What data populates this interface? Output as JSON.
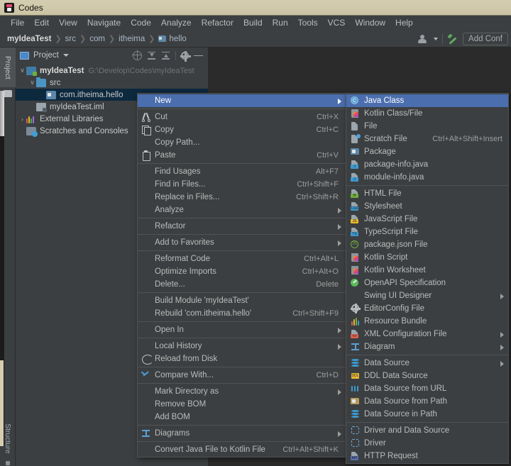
{
  "window": {
    "title": "Codes",
    "icon": "intellij-idea-icon"
  },
  "menubar": {
    "items": [
      {
        "label": "File"
      },
      {
        "label": "Edit"
      },
      {
        "label": "View"
      },
      {
        "label": "Navigate"
      },
      {
        "label": "Code"
      },
      {
        "label": "Analyze"
      },
      {
        "label": "Refactor"
      },
      {
        "label": "Build"
      },
      {
        "label": "Run"
      },
      {
        "label": "Tools"
      },
      {
        "label": "VCS"
      },
      {
        "label": "Window"
      },
      {
        "label": "Help"
      }
    ]
  },
  "navbar": {
    "crumbs": [
      "myIdeaTest",
      "src",
      "com",
      "itheima",
      "hello"
    ],
    "separator": "❯",
    "add_configuration": "Add Conf"
  },
  "toolwindow_strips": {
    "project": "Project",
    "structure": "Structure"
  },
  "project_panel": {
    "title": "Project",
    "tree": [
      {
        "label": "myIdeaTest",
        "path": "G:\\Develop\\Codes\\myIdeaTest",
        "icon": "module-icon",
        "arrow": "∨",
        "depth": 0,
        "bold": true
      },
      {
        "label": "src",
        "path": "",
        "icon": "source-folder-icon",
        "arrow": "∨",
        "depth": 1,
        "bold": false
      },
      {
        "label": "com.itheima.hello",
        "path": "",
        "icon": "package-icon",
        "arrow": "",
        "depth": 2,
        "bold": false,
        "selected": true
      },
      {
        "label": "myIdeaTest.iml",
        "path": "",
        "icon": "iml-file-icon",
        "arrow": "",
        "depth": 1,
        "bold": false
      },
      {
        "label": "External Libraries",
        "path": "",
        "icon": "libraries-icon",
        "arrow": "›",
        "depth": 0,
        "bold": false
      },
      {
        "label": "Scratches and Consoles",
        "path": "",
        "icon": "scratches-icon",
        "arrow": "",
        "depth": 0,
        "bold": false
      }
    ]
  },
  "context_menu": {
    "items": [
      {
        "label": "New",
        "accel": "",
        "icon": "",
        "submenu": true,
        "highlight": true
      },
      {
        "sep": true
      },
      {
        "label": "Cut",
        "accel": "Ctrl+X",
        "icon": "cut-icon"
      },
      {
        "label": "Copy",
        "accel": "Ctrl+C",
        "icon": "copy-icon"
      },
      {
        "label": "Copy Path...",
        "accel": "",
        "icon": ""
      },
      {
        "label": "Paste",
        "accel": "Ctrl+V",
        "icon": "paste-icon"
      },
      {
        "sep": true
      },
      {
        "label": "Find Usages",
        "accel": "Alt+F7",
        "icon": ""
      },
      {
        "label": "Find in Files...",
        "accel": "Ctrl+Shift+F",
        "icon": ""
      },
      {
        "label": "Replace in Files...",
        "accel": "Ctrl+Shift+R",
        "icon": ""
      },
      {
        "label": "Analyze",
        "accel": "",
        "icon": "",
        "submenu": true
      },
      {
        "sep": true
      },
      {
        "label": "Refactor",
        "accel": "",
        "icon": "",
        "submenu": true
      },
      {
        "sep": true
      },
      {
        "label": "Add to Favorites",
        "accel": "",
        "icon": "",
        "submenu": true
      },
      {
        "sep": true
      },
      {
        "label": "Reformat Code",
        "accel": "Ctrl+Alt+L",
        "icon": ""
      },
      {
        "label": "Optimize Imports",
        "accel": "Ctrl+Alt+O",
        "icon": ""
      },
      {
        "label": "Delete...",
        "accel": "Delete",
        "icon": ""
      },
      {
        "sep": true
      },
      {
        "label": "Build Module 'myIdeaTest'",
        "accel": "",
        "icon": ""
      },
      {
        "label": "Rebuild 'com.itheima.hello'",
        "accel": "Ctrl+Shift+F9",
        "icon": ""
      },
      {
        "sep": true
      },
      {
        "label": "Open In",
        "accel": "",
        "icon": "",
        "submenu": true
      },
      {
        "sep": true
      },
      {
        "label": "Local History",
        "accel": "",
        "icon": "",
        "submenu": true
      },
      {
        "label": "Reload from Disk",
        "accel": "",
        "icon": "reload-icon"
      },
      {
        "sep": true
      },
      {
        "label": "Compare With...",
        "accel": "Ctrl+D",
        "icon": "compare-icon"
      },
      {
        "sep": true
      },
      {
        "label": "Mark Directory as",
        "accel": "",
        "icon": "",
        "submenu": true
      },
      {
        "label": "Remove BOM",
        "accel": "",
        "icon": ""
      },
      {
        "label": "Add BOM",
        "accel": "",
        "icon": ""
      },
      {
        "sep": true
      },
      {
        "label": "Diagrams",
        "accel": "",
        "icon": "diagrams-icon",
        "submenu": true
      },
      {
        "sep": true
      },
      {
        "label": "Convert Java File to Kotlin File",
        "accel": "Ctrl+Alt+Shift+K",
        "icon": ""
      }
    ]
  },
  "new_submenu": {
    "items": [
      {
        "label": "Java Class",
        "accel": "",
        "icon": "java-class-icon",
        "highlight": true
      },
      {
        "label": "Kotlin Class/File",
        "accel": "",
        "icon": "kotlin-file-icon"
      },
      {
        "label": "File",
        "accel": "",
        "icon": "file-icon"
      },
      {
        "label": "Scratch File",
        "accel": "Ctrl+Alt+Shift+Insert",
        "icon": "scratch-file-icon"
      },
      {
        "label": "Package",
        "accel": "",
        "icon": "package-icon"
      },
      {
        "label": "package-info.java",
        "accel": "",
        "icon": "java-file-icon"
      },
      {
        "label": "module-info.java",
        "accel": "",
        "icon": "java-file-icon"
      },
      {
        "sep": true
      },
      {
        "label": "HTML File",
        "accel": "",
        "icon": "html-file-icon"
      },
      {
        "label": "Stylesheet",
        "accel": "",
        "icon": "css-file-icon"
      },
      {
        "label": "JavaScript File",
        "accel": "",
        "icon": "js-file-icon"
      },
      {
        "label": "TypeScript File",
        "accel": "",
        "icon": "ts-file-icon"
      },
      {
        "label": "package.json File",
        "accel": "",
        "icon": "nodejs-icon"
      },
      {
        "label": "Kotlin Script",
        "accel": "",
        "icon": "kotlin-script-icon"
      },
      {
        "label": "Kotlin Worksheet",
        "accel": "",
        "icon": "kotlin-worksheet-icon"
      },
      {
        "label": "OpenAPI Specification",
        "accel": "",
        "icon": "openapi-icon"
      },
      {
        "label": "Swing UI Designer",
        "accel": "",
        "icon": "",
        "submenu": true
      },
      {
        "label": "EditorConfig File",
        "accel": "",
        "icon": "gear-icon"
      },
      {
        "label": "Resource Bundle",
        "accel": "",
        "icon": "resource-bundle-icon"
      },
      {
        "label": "XML Configuration File",
        "accel": "",
        "icon": "xml-file-icon",
        "submenu": true
      },
      {
        "label": "Diagram",
        "accel": "",
        "icon": "diagram-icon",
        "submenu": true
      },
      {
        "sep": true
      },
      {
        "label": "Data Source",
        "accel": "",
        "icon": "data-source-icon",
        "submenu": true
      },
      {
        "label": "DDL Data Source",
        "accel": "",
        "icon": "ddl-data-source-icon"
      },
      {
        "label": "Data Source from URL",
        "accel": "",
        "icon": "data-source-url-icon"
      },
      {
        "label": "Data Source from Path",
        "accel": "",
        "icon": "folder-icon"
      },
      {
        "label": "Data Source in Path",
        "accel": "",
        "icon": "data-source-icon"
      },
      {
        "sep": true
      },
      {
        "label": "Driver and Data Source",
        "accel": "",
        "icon": "driver-icon"
      },
      {
        "label": "Driver",
        "accel": "",
        "icon": "driver-icon"
      },
      {
        "label": "HTTP Request",
        "accel": "",
        "icon": "http-request-icon"
      }
    ]
  },
  "colors": {
    "titlebar": "#cfc8aa",
    "chrome": "#3c3f41",
    "editor": "#2b2b2b",
    "menu_highlight": "#4b6eaf",
    "tree_selection": "#0d293e",
    "text": "#bbbbbb",
    "accel_text": "#9d9d9d"
  }
}
